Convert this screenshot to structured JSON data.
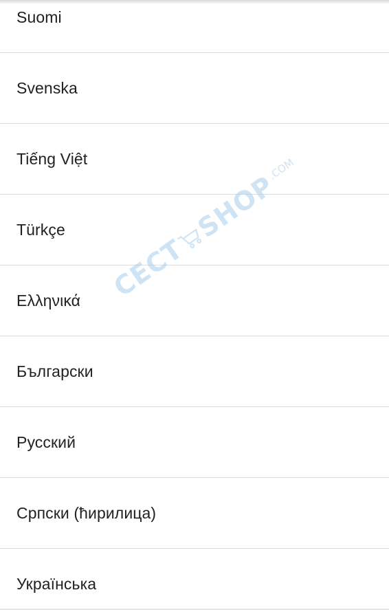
{
  "languages": [
    {
      "label": "Suomi"
    },
    {
      "label": "Svenska"
    },
    {
      "label": "Tiếng Việt"
    },
    {
      "label": "Türkçe"
    },
    {
      "label": "Ελληνικά"
    },
    {
      "label": "Български"
    },
    {
      "label": "Русский"
    },
    {
      "label": "Српски (ћирилица)"
    },
    {
      "label": "Українська"
    }
  ],
  "watermark": {
    "left_text": "CECT",
    "right_text": "SHOP",
    "suffix": ".COM",
    "icon": "shopping-cart-icon",
    "color": "#a7cfee"
  }
}
